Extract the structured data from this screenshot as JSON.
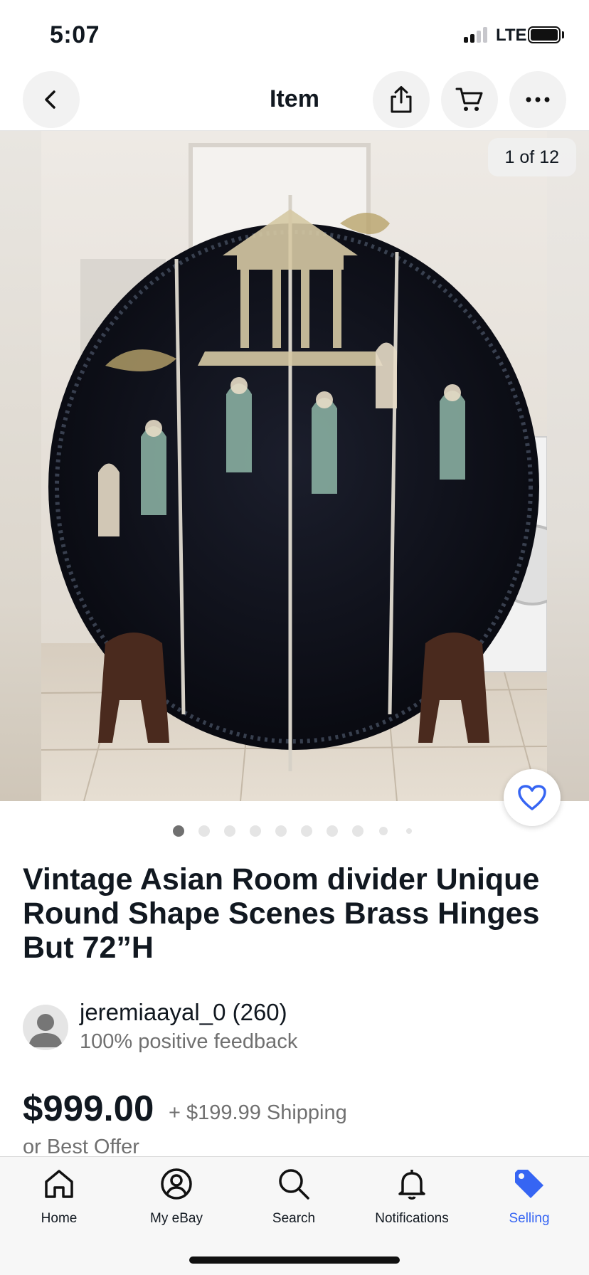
{
  "status_bar": {
    "time": "5:07",
    "network": "LTE",
    "signal_icon": "signal-bars-icon",
    "battery_icon": "battery-icon"
  },
  "nav": {
    "title": "Item",
    "back_icon": "chevron-left-icon",
    "share_icon": "share-icon",
    "cart_icon": "cart-icon",
    "more_icon": "more-horizontal-icon"
  },
  "gallery": {
    "counter": "1 of 12",
    "favorite_icon": "heart-icon",
    "accent_color": "#3665f3"
  },
  "listing": {
    "title": "Vintage Asian Room divider Unique Round Shape Scenes Brass Hinges But 72”H",
    "seller": {
      "name": "jeremiaayal_0 (260)",
      "feedback": "100% positive feedback"
    },
    "price": "$999.00",
    "shipping": "+ $199.99 Shipping",
    "best_offer": "or Best Offer"
  },
  "tab_bar": {
    "tabs": [
      {
        "label": "Home",
        "icon": "home-icon",
        "active": false
      },
      {
        "label": "My eBay",
        "icon": "user-circle-icon",
        "active": false
      },
      {
        "label": "Search",
        "icon": "search-icon",
        "active": false
      },
      {
        "label": "Notifications",
        "icon": "bell-icon",
        "active": false
      },
      {
        "label": "Selling",
        "icon": "tag-icon",
        "active": true
      }
    ]
  }
}
